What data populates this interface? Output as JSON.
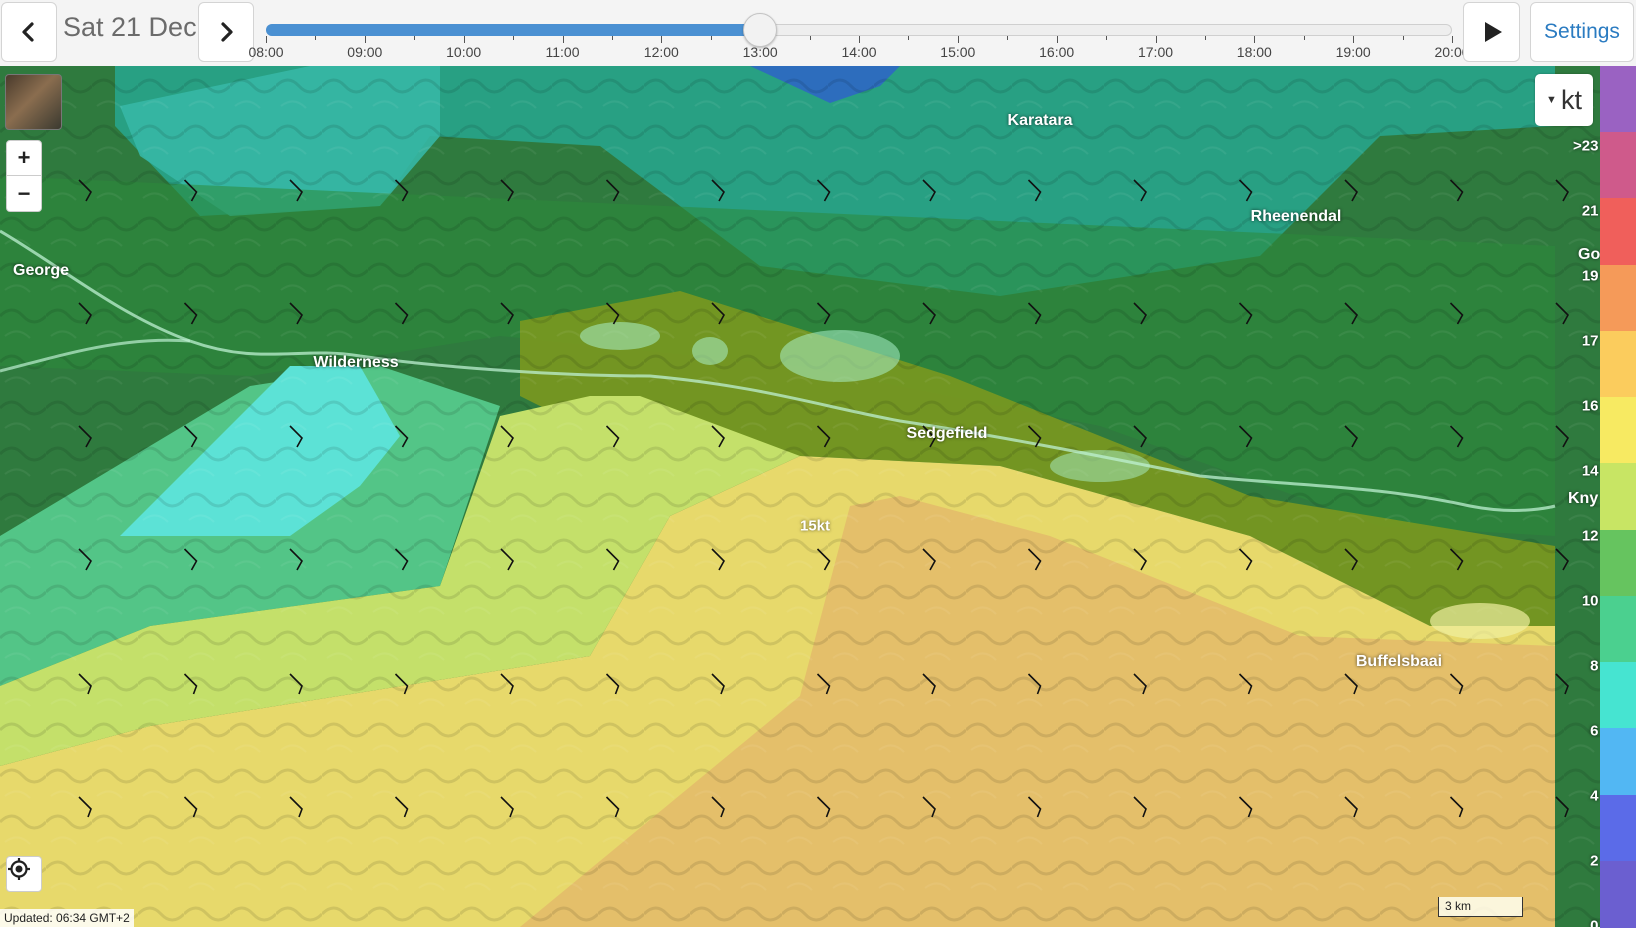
{
  "toolbar": {
    "date": "Sat 21 Dec",
    "settings_label": "Settings",
    "prev_icon": "chevron-left-icon",
    "next_icon": "chevron-right-icon",
    "play_icon": "play-icon"
  },
  "timeline": {
    "hours": [
      "08:00",
      "09:00",
      "10:00",
      "11:00",
      "12:00",
      "13:00",
      "14:00",
      "15:00",
      "16:00",
      "17:00",
      "18:00",
      "19:00",
      "20:00"
    ],
    "current": "13:00",
    "progress": 0.4167
  },
  "map": {
    "unit_label": "kt",
    "zoom_in_label": "+",
    "zoom_out_label": "−",
    "places": [
      {
        "name": "Karatara"
      },
      {
        "name": "Rheenendal"
      },
      {
        "name": "George"
      },
      {
        "name": "Wilderness"
      },
      {
        "name": "Sedgefield"
      },
      {
        "name": "Buffelsbaai"
      },
      {
        "name": "Go"
      },
      {
        "name": "Kny"
      }
    ],
    "wind_label": "15kt",
    "scale_bar": "3 km",
    "updated": "Updated: 06:34 GMT+2",
    "scale_labels": [
      ">23",
      "21",
      "19",
      "17",
      "16",
      "14",
      "12",
      "10",
      "8",
      "6",
      "4",
      "2",
      "0"
    ]
  },
  "legend_colors": [
    "#9a62c2",
    "#cf5a8b",
    "#f05f5b",
    "#f59a59",
    "#fbcc5d",
    "#f7ea62",
    "#c8e564",
    "#66c45f",
    "#4bd08f",
    "#46e4d1",
    "#52b7f3",
    "#5b6be8",
    "#6b5fd0"
  ],
  "accent_color": "#2a7bc1"
}
